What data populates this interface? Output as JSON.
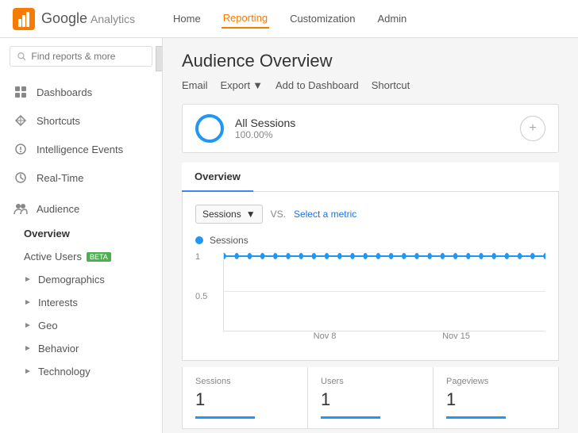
{
  "header": {
    "logo_google": "Google",
    "logo_analytics": "Analytics",
    "nav": [
      {
        "label": "Home",
        "active": false
      },
      {
        "label": "Reporting",
        "active": true
      },
      {
        "label": "Customization",
        "active": false
      },
      {
        "label": "Admin",
        "active": false
      }
    ]
  },
  "sidebar": {
    "search_placeholder": "Find reports & more",
    "items": [
      {
        "id": "dashboards",
        "label": "Dashboards"
      },
      {
        "id": "shortcuts",
        "label": "Shortcuts"
      },
      {
        "id": "intelligence",
        "label": "Intelligence Events"
      },
      {
        "id": "realtime",
        "label": "Real-Time"
      },
      {
        "id": "audience",
        "label": "Audience"
      }
    ],
    "audience_sub": [
      {
        "id": "overview",
        "label": "Overview",
        "active": true
      },
      {
        "id": "active-users",
        "label": "Active Users",
        "beta": true
      },
      {
        "id": "demographics",
        "label": "Demographics",
        "expandable": true
      },
      {
        "id": "interests",
        "label": "Interests",
        "expandable": true
      },
      {
        "id": "geo",
        "label": "Geo",
        "expandable": true
      },
      {
        "id": "behavior",
        "label": "Behavior",
        "expandable": true
      },
      {
        "id": "technology",
        "label": "Technology",
        "expandable": true
      }
    ]
  },
  "main": {
    "page_title": "Audience Overview",
    "actions": {
      "email": "Email",
      "export": "Export",
      "add_to_dashboard": "Add to Dashboard",
      "shortcut": "Shortcut"
    },
    "segment": {
      "name": "All Sessions",
      "percent": "100.00%",
      "add_label": "+"
    },
    "tabs": [
      {
        "label": "Overview",
        "active": true
      }
    ],
    "chart": {
      "metric_label": "Sessions",
      "vs_label": "VS.",
      "select_metric": "Select a metric",
      "legend_sessions": "Sessions",
      "y_labels": [
        "1",
        "0.5"
      ],
      "x_labels": [
        "Nov 8",
        "Nov 15"
      ],
      "data_points": [
        1,
        1,
        1,
        1,
        1,
        1,
        1,
        1,
        1,
        1,
        1,
        1,
        1,
        1,
        1,
        1,
        1,
        1,
        1,
        1,
        1,
        1,
        1,
        1,
        1
      ]
    },
    "stats": [
      {
        "label": "Sessions",
        "value": "1"
      },
      {
        "label": "Users",
        "value": "1"
      },
      {
        "label": "Pageviews",
        "value": "1"
      }
    ]
  }
}
